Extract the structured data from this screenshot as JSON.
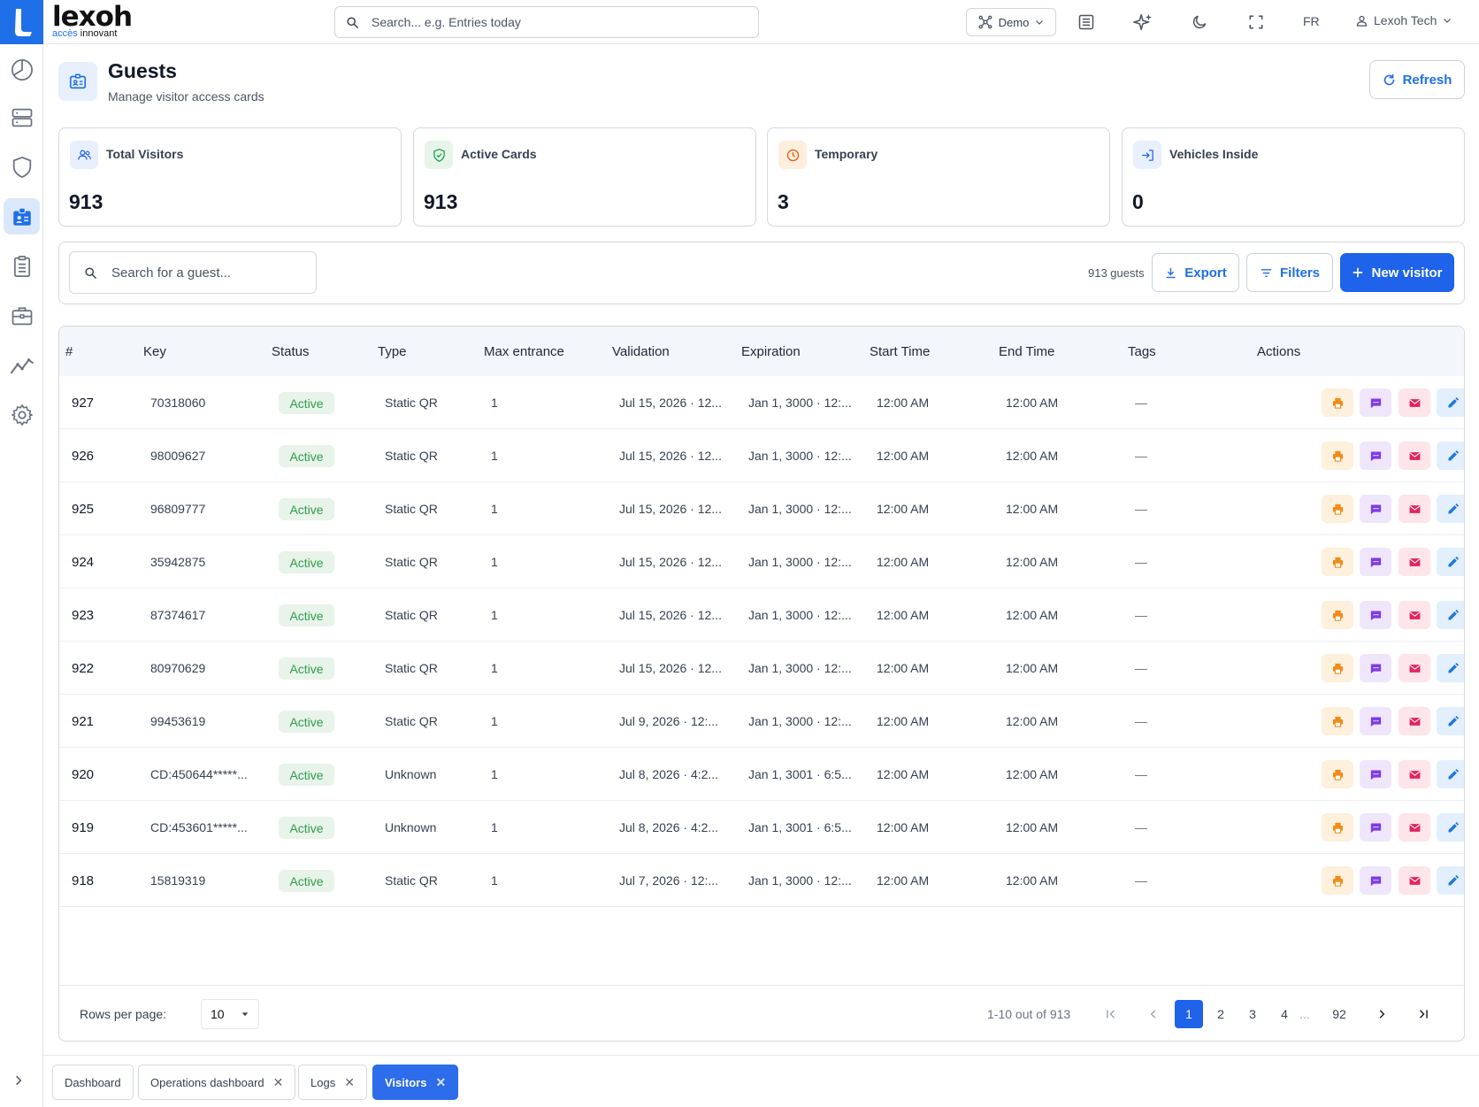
{
  "brand": {
    "name": "lexoh",
    "sub_accent": "accès",
    "sub_rest": " innovant"
  },
  "topbar": {
    "search_placeholder": "Search... e.g. Entries today",
    "workspace": "Demo",
    "lang": "FR",
    "user": "Lexoh Tech"
  },
  "header": {
    "title": "Guests",
    "subtitle": "Manage visitor access cards",
    "refresh": "Refresh"
  },
  "stats": [
    {
      "label": "Total Visitors",
      "value": "913",
      "icon": "users-icon",
      "color": "#2563eb"
    },
    {
      "label": "Active Cards",
      "value": "913",
      "icon": "shield-check-icon",
      "color": "#16a34a"
    },
    {
      "label": "Temporary",
      "value": "3",
      "icon": "clock-icon",
      "color": "#ea580c"
    },
    {
      "label": "Vehicles Inside",
      "value": "0",
      "icon": "login-icon",
      "color": "#2563eb"
    }
  ],
  "toolbar": {
    "search_placeholder": "Search for a guest...",
    "count": "913 guests",
    "export": "Export",
    "filters": "Filters",
    "new_visitor": "New visitor"
  },
  "table": {
    "columns": [
      "#",
      "Key",
      "Status",
      "Type",
      "Max entrance",
      "Validation",
      "Expiration",
      "Start Time",
      "End Time",
      "Tags",
      "Actions"
    ],
    "rows": [
      {
        "id": "927",
        "key": "70318060",
        "status": "Active",
        "type": "Static QR",
        "max": "1",
        "validation": "Jul 15, 2026 · 12...",
        "expiration": "Jan 1, 3000 · 12:...",
        "start": "12:00 AM",
        "end": "12:00 AM",
        "tags": "—"
      },
      {
        "id": "926",
        "key": "98009627",
        "status": "Active",
        "type": "Static QR",
        "max": "1",
        "validation": "Jul 15, 2026 · 12...",
        "expiration": "Jan 1, 3000 · 12:...",
        "start": "12:00 AM",
        "end": "12:00 AM",
        "tags": "—"
      },
      {
        "id": "925",
        "key": "96809777",
        "status": "Active",
        "type": "Static QR",
        "max": "1",
        "validation": "Jul 15, 2026 · 12...",
        "expiration": "Jan 1, 3000 · 12:...",
        "start": "12:00 AM",
        "end": "12:00 AM",
        "tags": "—"
      },
      {
        "id": "924",
        "key": "35942875",
        "status": "Active",
        "type": "Static QR",
        "max": "1",
        "validation": "Jul 15, 2026 · 12...",
        "expiration": "Jan 1, 3000 · 12:...",
        "start": "12:00 AM",
        "end": "12:00 AM",
        "tags": "—"
      },
      {
        "id": "923",
        "key": "87374617",
        "status": "Active",
        "type": "Static QR",
        "max": "1",
        "validation": "Jul 15, 2026 · 12...",
        "expiration": "Jan 1, 3000 · 12:...",
        "start": "12:00 AM",
        "end": "12:00 AM",
        "tags": "—"
      },
      {
        "id": "922",
        "key": "80970629",
        "status": "Active",
        "type": "Static QR",
        "max": "1",
        "validation": "Jul 15, 2026 · 12...",
        "expiration": "Jan 1, 3000 · 12:...",
        "start": "12:00 AM",
        "end": "12:00 AM",
        "tags": "—"
      },
      {
        "id": "921",
        "key": "99453619",
        "status": "Active",
        "type": "Static QR",
        "max": "1",
        "validation": "Jul 9, 2026 · 12:...",
        "expiration": "Jan 1, 3000 · 12:...",
        "start": "12:00 AM",
        "end": "12:00 AM",
        "tags": "—"
      },
      {
        "id": "920",
        "key": "CD:450644*****...",
        "status": "Active",
        "type": "Unknown",
        "max": "1",
        "validation": "Jul 8, 2026 · 4:2...",
        "expiration": "Jan 1, 3001 · 6:5...",
        "start": "12:00 AM",
        "end": "12:00 AM",
        "tags": "—"
      },
      {
        "id": "919",
        "key": "CD:453601*****...",
        "status": "Active",
        "type": "Unknown",
        "max": "1",
        "validation": "Jul 8, 2026 · 4:2...",
        "expiration": "Jan 1, 3001 · 6:5...",
        "start": "12:00 AM",
        "end": "12:00 AM",
        "tags": "—"
      },
      {
        "id": "918",
        "key": "15819319",
        "status": "Active",
        "type": "Static QR",
        "max": "1",
        "validation": "Jul 7, 2026 · 12:...",
        "expiration": "Jan 1, 3000 · 12:...",
        "start": "12:00 AM",
        "end": "12:00 AM",
        "tags": "—"
      }
    ]
  },
  "pagination": {
    "rows_per_page_label": "Rows per page:",
    "rows_per_page": "10",
    "range": "1-10 out of 913",
    "pages": [
      "1",
      "2",
      "3",
      "4"
    ],
    "ellipsis": "...",
    "last": "92"
  },
  "tabs": [
    {
      "label": "Dashboard",
      "closable": false,
      "active": false
    },
    {
      "label": "Operations dashboard",
      "closable": true,
      "active": false
    },
    {
      "label": "Logs",
      "closable": true,
      "active": false
    },
    {
      "label": "Visitors",
      "closable": true,
      "active": true
    }
  ]
}
